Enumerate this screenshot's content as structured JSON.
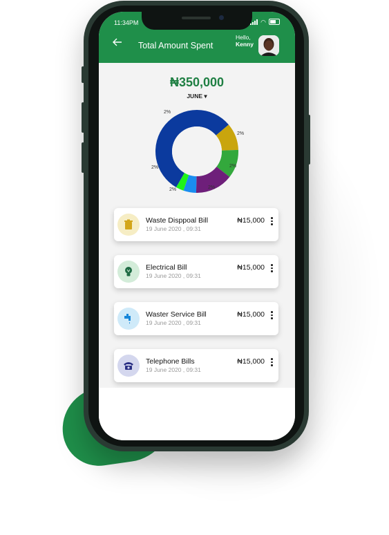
{
  "status_bar": {
    "time": "11:34PM"
  },
  "header": {
    "back_icon": "arrow-left-icon",
    "title": "Total Amount Spent",
    "greeting": "Hello,",
    "user_name": "Kenny"
  },
  "summary": {
    "amount": "₦350,000",
    "month": "JUNE"
  },
  "colors": {
    "brand_green": "#1f8f4a",
    "amount_green": "#1f7f43",
    "blob_green": "#1f8f4a"
  },
  "donut": {
    "segments": [
      {
        "color": "#0b3a9e",
        "label": "2%"
      },
      {
        "color": "#c9a50d",
        "label": "2%"
      },
      {
        "color": "#33a83c",
        "label": "2%"
      },
      {
        "color": "#6e1f7a",
        "label": "2%"
      },
      {
        "color": "#1a8df0",
        "label": "2%"
      },
      {
        "color": "#1ef41a",
        "label": "2%"
      }
    ]
  },
  "bills": [
    {
      "name": "Waste Disppoal Bill",
      "date": "19 June 2020 , 09:31",
      "amount": "₦15,000",
      "icon": "trash-bin-icon",
      "icon_bg": "#f6edc4",
      "icon_color": "#d3a61a"
    },
    {
      "name": "Electrical Bill",
      "date": "19 June 2020 , 09:31",
      "amount": "₦15,000",
      "icon": "light-bulb-icon",
      "icon_bg": "#d3ecd9",
      "icon_color": "#1f6b44"
    },
    {
      "name": "Waster Service Bill",
      "date": "19 June 2020 , 09:31",
      "amount": "₦15,000",
      "icon": "water-tap-icon",
      "icon_bg": "#cfeaf9",
      "icon_color": "#1686d9"
    },
    {
      "name": "Telephone Bills",
      "date": "19 June 2020 , 09:31",
      "amount": "₦15,000",
      "icon": "telephone-icon",
      "icon_bg": "#d4d7ee",
      "icon_color": "#2a2f84"
    }
  ]
}
